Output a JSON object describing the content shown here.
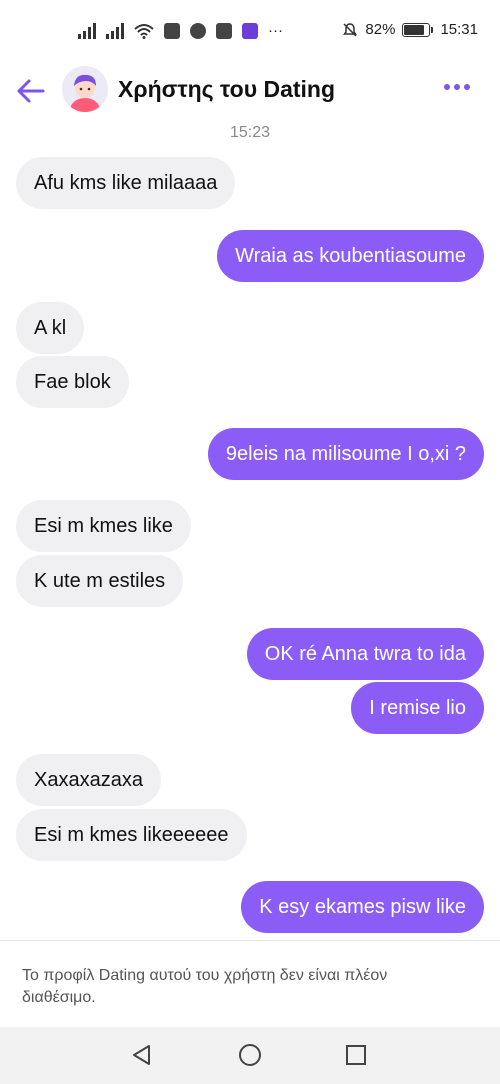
{
  "status_bar": {
    "battery_percent": "82%",
    "time": "15:31",
    "more_indicator": "···",
    "icons": [
      "signal-icon",
      "signal-icon",
      "wifi-icon",
      "app-icon",
      "app-icon",
      "app-icon",
      "app-icon",
      "mute-icon",
      "battery-icon"
    ],
    "battery_level": 0.82
  },
  "header": {
    "title": "Χρήστης του Dating",
    "back_icon": "back-arrow-icon",
    "more_icon": "more-options-icon",
    "accent_color": "#7b55ee"
  },
  "chat": {
    "timestamp": "15:23",
    "bubble_colors": {
      "incoming": "#f0f0f3",
      "outgoing": "#8b5cf6"
    },
    "messages": [
      {
        "direction": "in",
        "text": "Afu kms like milaaaa"
      },
      {
        "direction": "out",
        "text": "Wraia as koubentiasoume"
      },
      {
        "direction": "in",
        "text": "A kl"
      },
      {
        "direction": "in",
        "text": "Fae blok"
      },
      {
        "direction": "out",
        "text": "9eleis na milisoume I o,xi ?"
      },
      {
        "direction": "in",
        "text": "Esi m kmes like"
      },
      {
        "direction": "in",
        "text": "K ute m estiles"
      },
      {
        "direction": "out",
        "text": "OK ré Anna twra to ida"
      },
      {
        "direction": "out",
        "text": "I remise lio"
      },
      {
        "direction": "in",
        "text": "Xaxaxazaxa"
      },
      {
        "direction": "in",
        "text": "Esi m kmes likeeeeee"
      },
      {
        "direction": "out",
        "text": "K esy ekames pisw like"
      }
    ]
  },
  "notice": {
    "text": "Το προφίλ Dating αυτού του χρήστη δεν είναι πλέον διαθέσιμο."
  },
  "nav_bar": {
    "buttons": [
      "back-triangle-icon",
      "home-circle-icon",
      "recents-square-icon"
    ]
  }
}
